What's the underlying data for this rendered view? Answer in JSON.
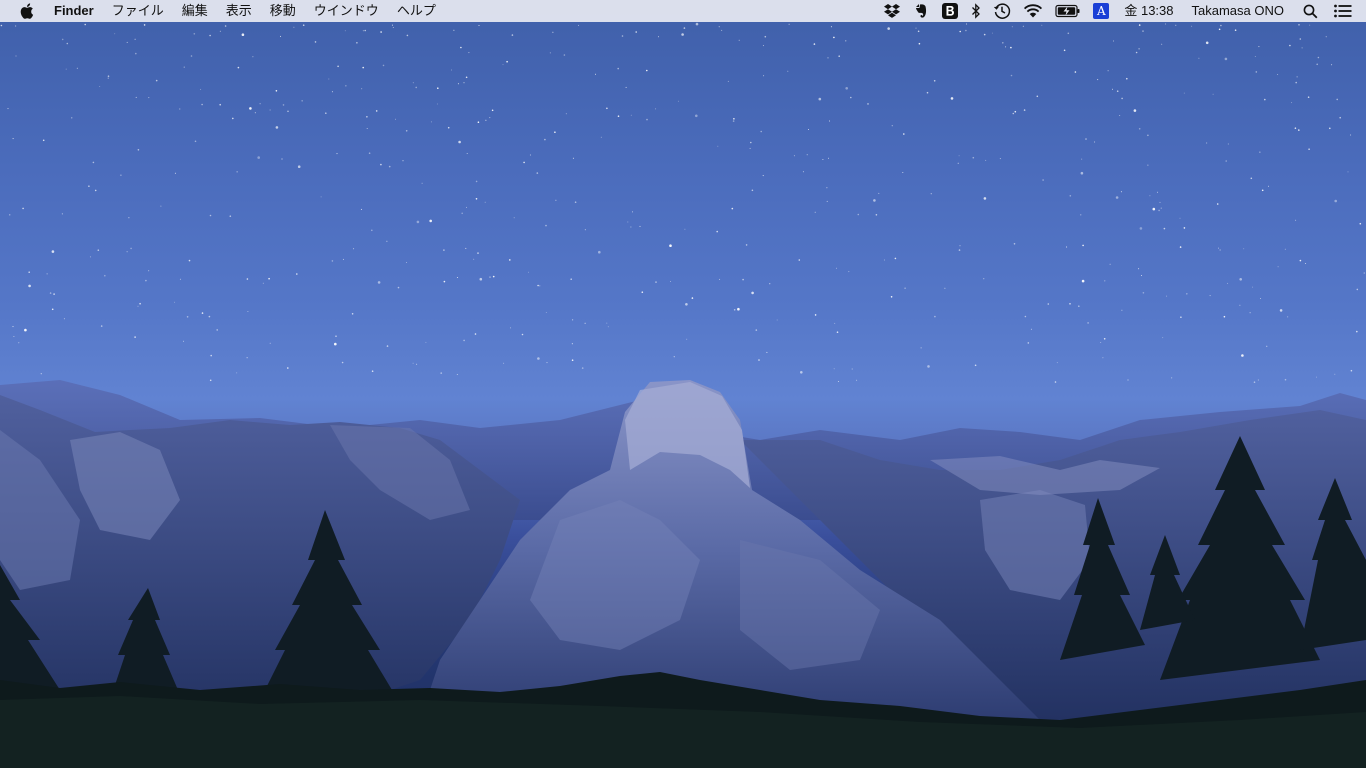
{
  "menubar": {
    "app_name": "Finder",
    "menus": [
      "ファイル",
      "編集",
      "表示",
      "移動",
      "ウインドウ",
      "ヘルプ"
    ],
    "status_icons": [
      "dropbox-icon",
      "evernote-icon",
      "b-app-icon",
      "bluetooth-icon",
      "time-machine-icon",
      "wifi-icon",
      "battery-charging-icon"
    ],
    "input_source": "A",
    "clock": "金 13:38",
    "user": "Takamasa ONO"
  },
  "desktop": {
    "wallpaper": "starry-sky-over-mountain-valley",
    "colors": {
      "sky_top": "#3f5fa9",
      "sky_horizon": "#6183d2",
      "mountains": "#4a5a96",
      "trees": "#101c24",
      "menubar": "#e8eaf2",
      "input_source_badge": "#1a3fd6"
    }
  }
}
